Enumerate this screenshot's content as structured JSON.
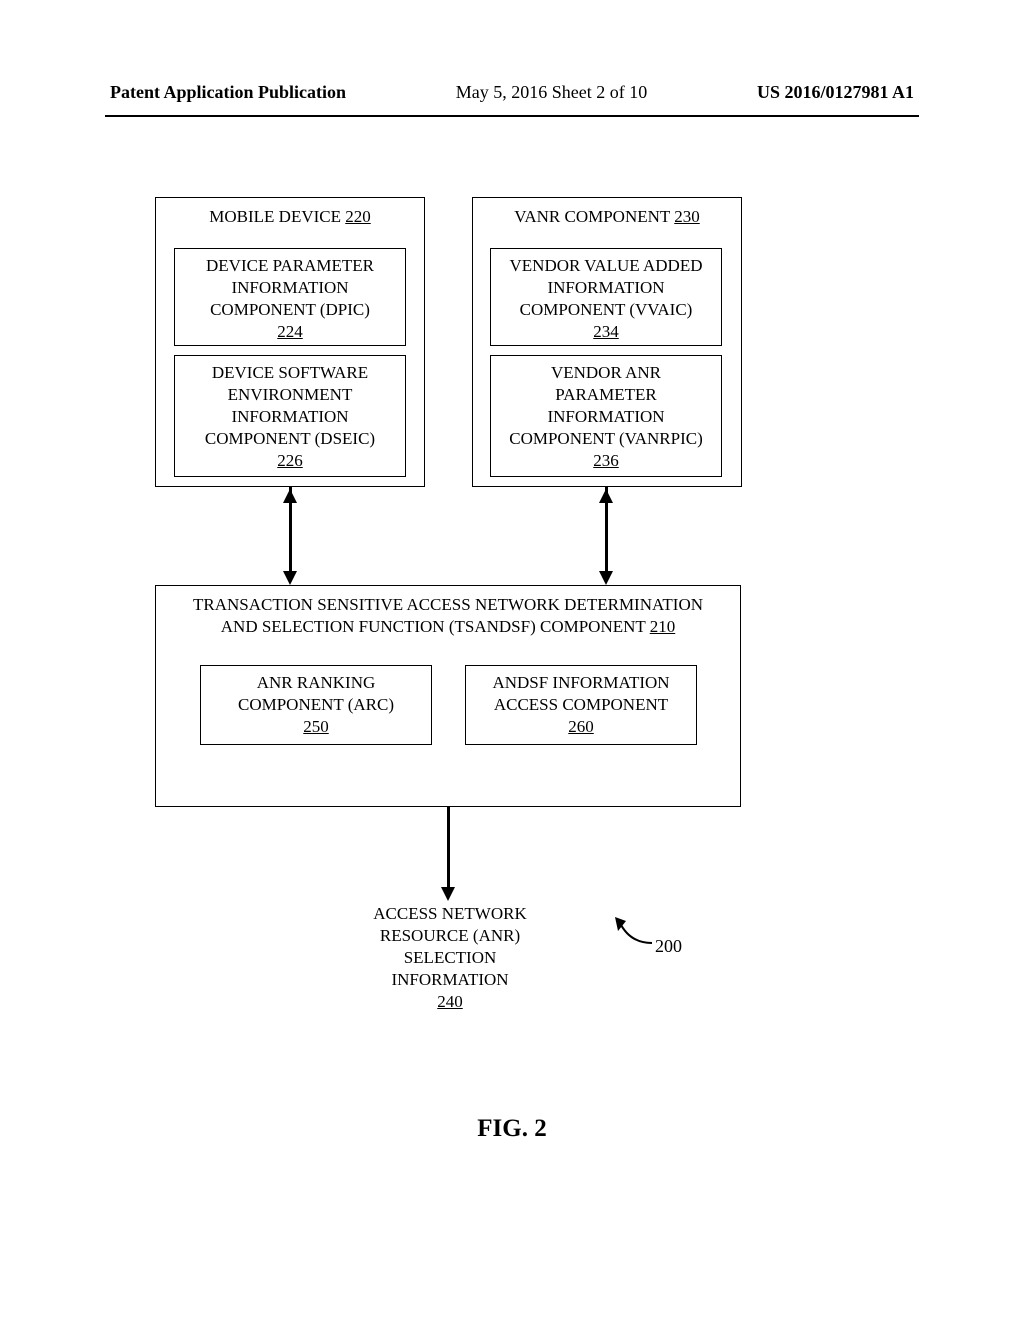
{
  "header": {
    "left": "Patent Application Publication",
    "center": "May 5, 2016  Sheet 2 of 10",
    "right": "US 2016/0127981 A1"
  },
  "mobile_device": {
    "title": "MOBILE DEVICE",
    "ref": "220",
    "dpic": {
      "line1": "DEVICE PARAMETER",
      "line2": "INFORMATION",
      "line3": "COMPONENT (DPIC)",
      "ref": "224"
    },
    "dseic": {
      "line1": "DEVICE SOFTWARE",
      "line2": "ENVIRONMENT",
      "line3": "INFORMATION",
      "line4": "COMPONENT (DSEIC)",
      "ref": "226"
    }
  },
  "vanr_component": {
    "title": "VANR COMPONENT",
    "ref": "230",
    "vvaic": {
      "line1": "VENDOR VALUE ADDED",
      "line2": "INFORMATION",
      "line3": "COMPONENT (VVAIC)",
      "ref": "234"
    },
    "vanrpic": {
      "line1": "VENDOR ANR",
      "line2": "PARAMETER",
      "line3": "INFORMATION",
      "line4": "COMPONENT (VANRPIC)",
      "ref": "236"
    }
  },
  "tsandsf": {
    "line1": "TRANSACTION SENSITIVE ACCESS NETWORK DETERMINATION",
    "line2": "AND SELECTION FUNCTION (TSANDSF) COMPONENT",
    "ref": "210",
    "arc": {
      "line1": "ANR RANKING",
      "line2": "COMPONENT (ARC)",
      "ref": "250"
    },
    "andsf": {
      "line1": "ANDSF INFORMATION",
      "line2": "ACCESS COMPONENT",
      "ref": "260"
    }
  },
  "output": {
    "line1": "ACCESS NETWORK",
    "line2": "RESOURCE (ANR)",
    "line3": "SELECTION",
    "line4": "INFORMATION",
    "ref": "240"
  },
  "system_ref": "200",
  "figure_caption": "FIG. 2"
}
